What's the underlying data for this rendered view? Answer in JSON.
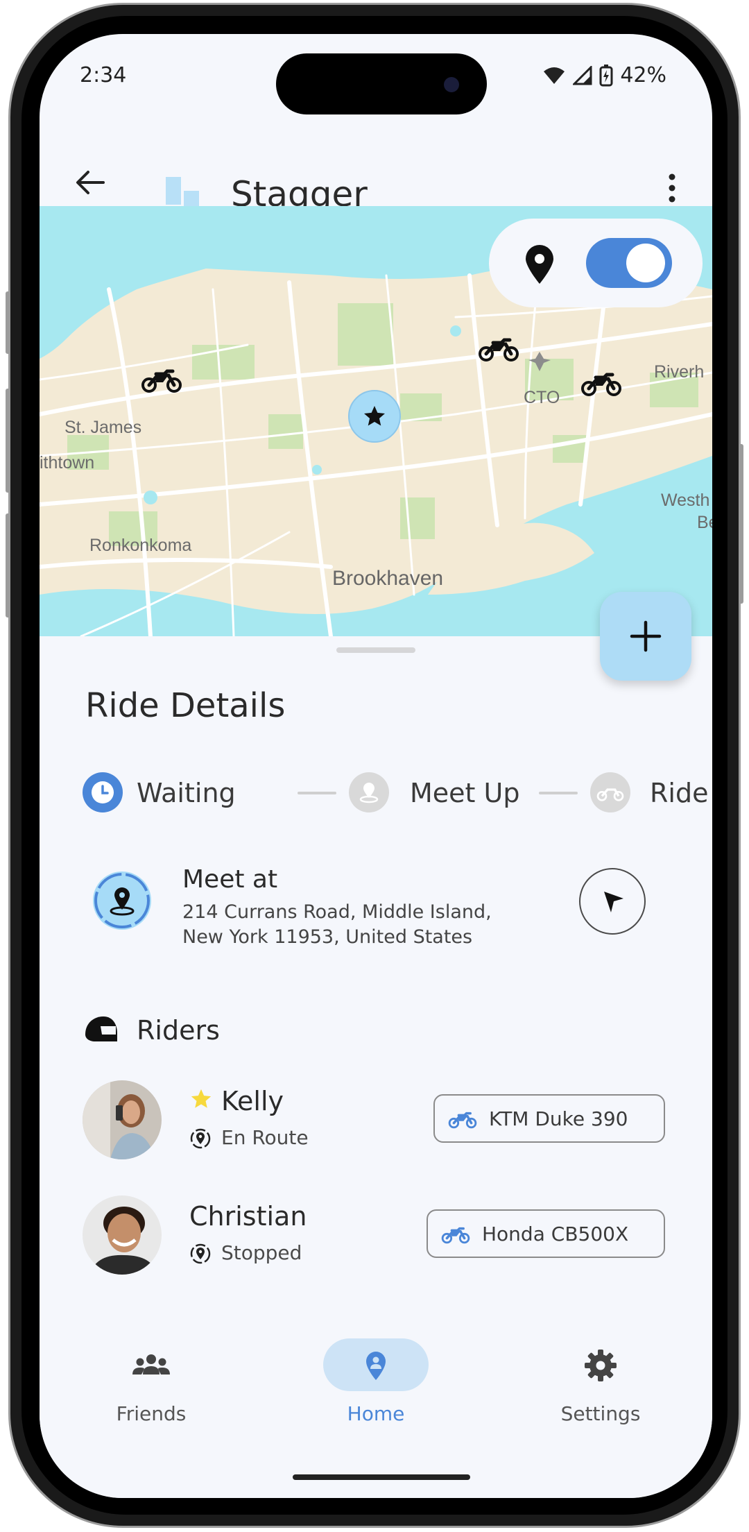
{
  "status_bar": {
    "time": "2:34",
    "battery": "42%"
  },
  "appbar": {
    "title": "Stagger"
  },
  "map": {
    "labels": [
      "St. James",
      "ithtown",
      "Ronkonkoma",
      "Brookhaven",
      "CTO",
      "Riverh",
      "Westh",
      "Be"
    ],
    "location_toggle_on": true
  },
  "sheet": {
    "title": "Ride Details",
    "steps": [
      {
        "label": "Waiting",
        "active": true
      },
      {
        "label": "Meet Up",
        "active": false
      },
      {
        "label": "Ride",
        "active": false
      }
    ],
    "meet": {
      "title": "Meet at",
      "address_line1": "214 Currans Road, Middle Island,",
      "address_line2": "New York 11953, United States"
    },
    "riders_title": "Riders",
    "riders": [
      {
        "name": "Kelly",
        "status": "En Route",
        "bike": "KTM Duke 390",
        "leader": true
      },
      {
        "name": "Christian",
        "status": "Stopped",
        "bike": "Honda CB500X",
        "leader": false
      }
    ]
  },
  "bottom_nav": {
    "items": [
      {
        "label": "Friends",
        "icon": "group-icon",
        "active": false
      },
      {
        "label": "Home",
        "icon": "home-pin-icon",
        "active": true
      },
      {
        "label": "Settings",
        "icon": "gear-icon",
        "active": false
      }
    ]
  },
  "colors": {
    "accent": "#4a86d8",
    "map_water": "#a7e8f0",
    "map_land": "#f3ead5",
    "fab": "#aedcf6",
    "star": "#f7d93d"
  }
}
